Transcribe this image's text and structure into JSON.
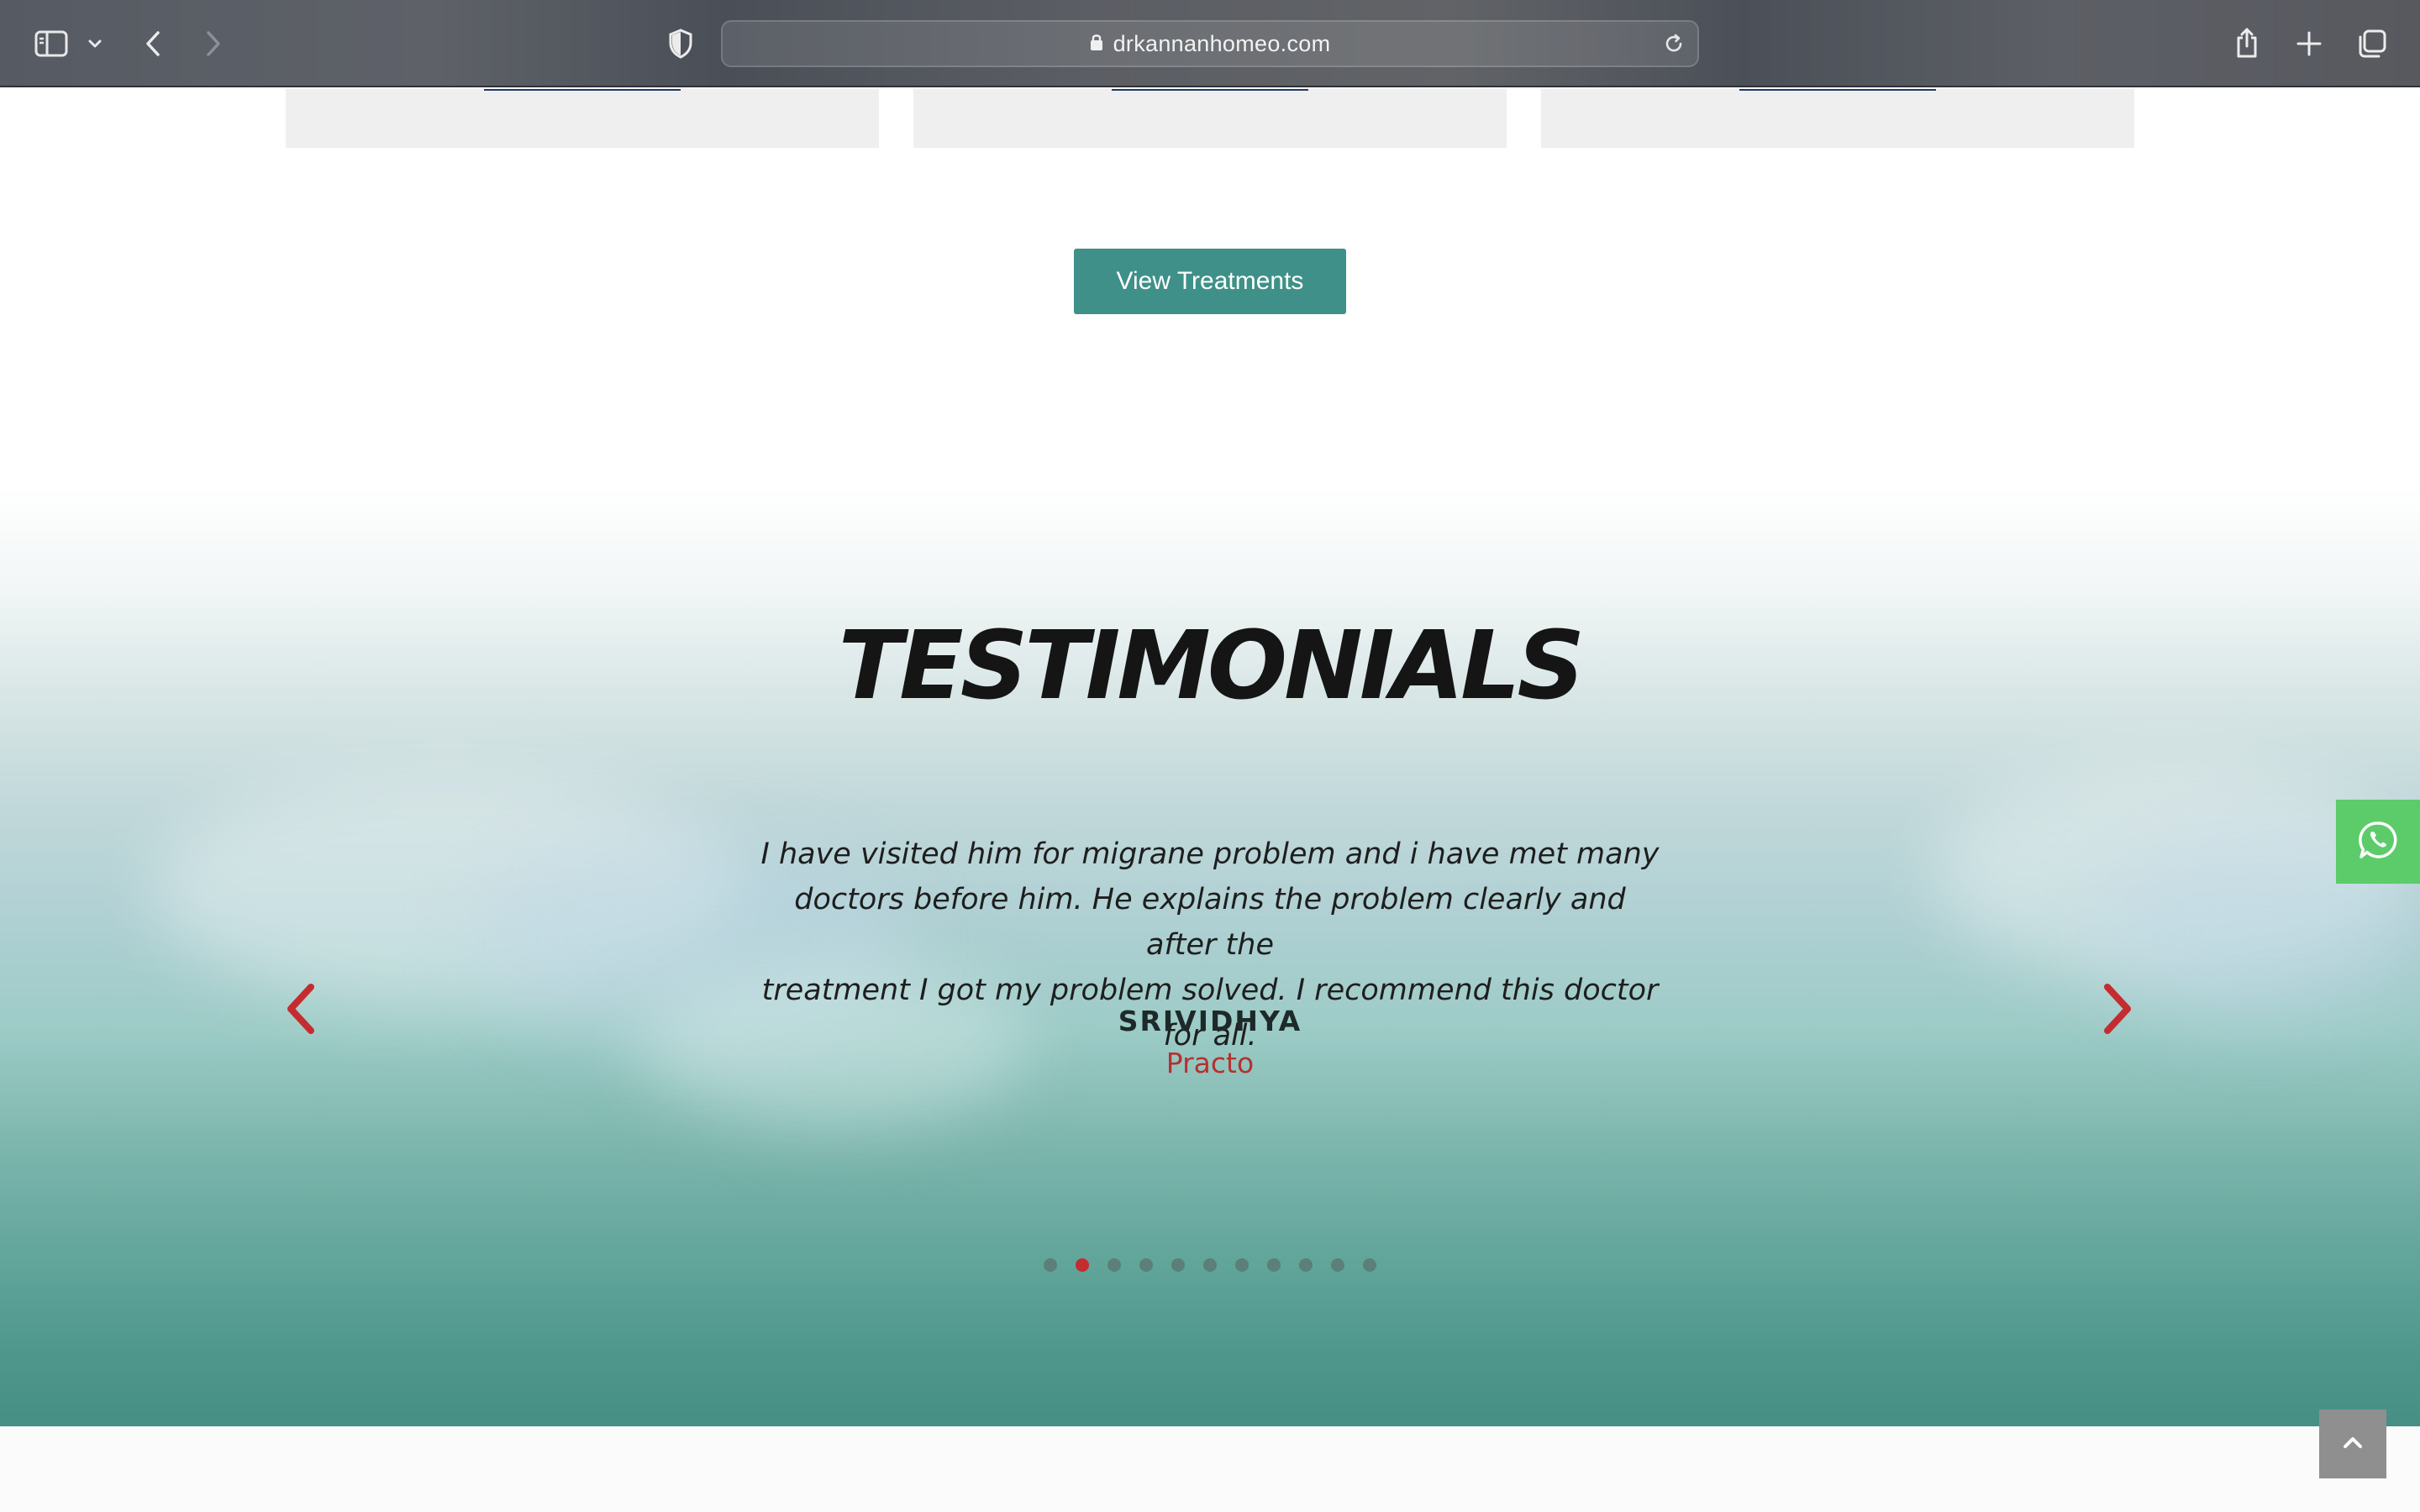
{
  "browser": {
    "url": "drkannanhomeo.com",
    "icons": {
      "sidebar": "sidebar-icon",
      "chevron": "chevron-down-icon",
      "back": "back-icon",
      "forward": "forward-icon",
      "shield": "shield-icon",
      "lock": "lock-icon",
      "reload": "reload-icon",
      "share": "share-icon",
      "new_tab": "plus-icon",
      "tabs": "tabs-overview-icon"
    }
  },
  "treatments": {
    "button_label": "View Treatments"
  },
  "testimonials": {
    "heading": "TESTIMONIALS",
    "quote_lines": [
      "I have visited him for migrane problem and i have met many",
      "doctors before him. He explains the problem clearly and after the",
      "treatment I got my problem solved. I recommend this doctor for all."
    ],
    "author": "SRIVIDHYA",
    "source": "Practo",
    "slide_count": 11,
    "active_slide": 2
  },
  "colors": {
    "teal": "#3f9088",
    "accent_red": "#c52c30",
    "whatsapp_green": "#5ccc6b"
  }
}
